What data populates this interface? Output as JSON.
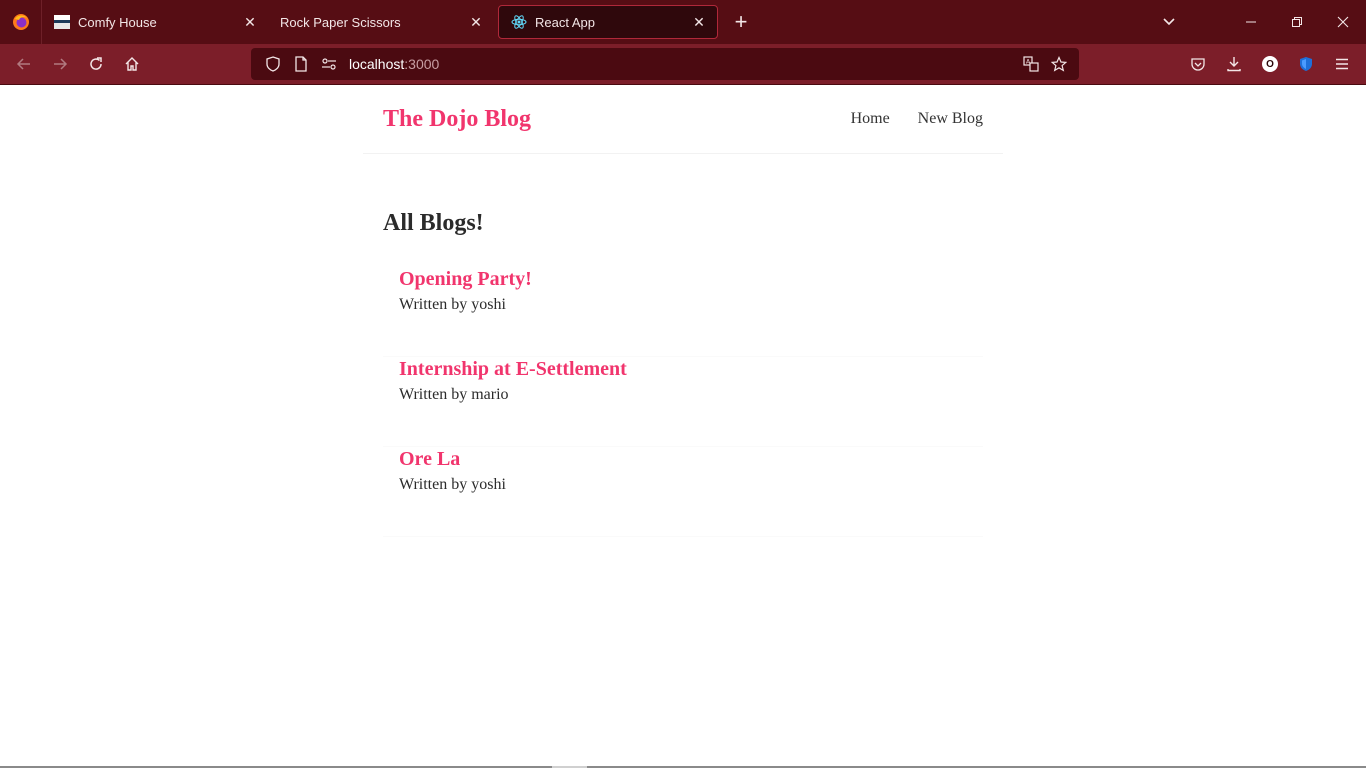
{
  "browser": {
    "tabs": [
      {
        "title": "Comfy House",
        "icon": "comfy-house-favicon",
        "active": false
      },
      {
        "title": "Rock Paper Scissors",
        "icon": "none",
        "active": false
      },
      {
        "title": "React App",
        "icon": "react-favicon",
        "active": true
      }
    ],
    "url": {
      "host": "localhost",
      "port": ":3000"
    },
    "account_initial": "O"
  },
  "colors": {
    "tabbar": "#560d14",
    "toolbar": "#7c1e29",
    "accent": "#f1356d",
    "text": "#333333"
  },
  "site": {
    "title": "The Dojo Blog",
    "nav": {
      "home": "Home",
      "new_blog": "New Blog"
    }
  },
  "page": {
    "heading": "All Blogs!",
    "blogs": [
      {
        "title": "Opening Party!",
        "author": "Written by yoshi"
      },
      {
        "title": "Internship at E-Settlement",
        "author": "Written by mario"
      },
      {
        "title": "Ore La",
        "author": "Written by yoshi"
      }
    ]
  }
}
